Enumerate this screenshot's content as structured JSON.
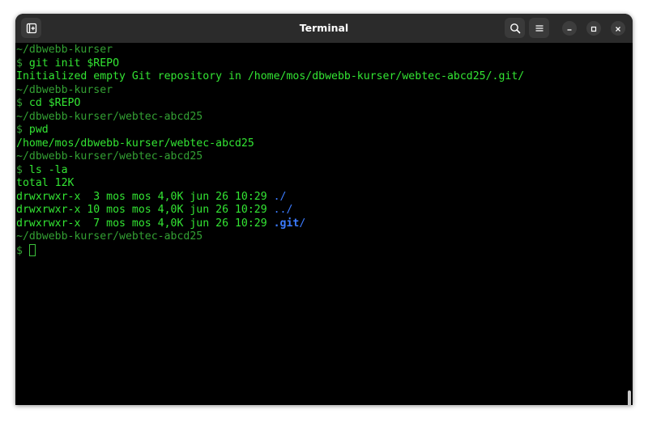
{
  "window": {
    "title": "Terminal"
  },
  "titlebar": {
    "new_tab_icon": "new-tab-icon",
    "search_icon": "search-icon",
    "menu_icon": "hamburger-menu-icon",
    "minimize_icon": "minimize-icon",
    "maximize_icon": "maximize-icon",
    "close_icon": "close-icon"
  },
  "colors": {
    "output_green": "#33e533",
    "prompt_dim_green": "#33a033",
    "directory_blue": "#3b7bff",
    "titlebar_bg": "#2b2b2b",
    "terminal_bg": "#000000"
  },
  "terminal": {
    "lines": [
      {
        "kind": "prompt-path",
        "segments": [
          {
            "text": "~/dbwebb-kurser",
            "color": "dim"
          }
        ]
      },
      {
        "kind": "command",
        "segments": [
          {
            "text": "$ ",
            "color": "dim"
          },
          {
            "text": "git init $REPO",
            "color": "green"
          }
        ]
      },
      {
        "kind": "output",
        "segments": [
          {
            "text": "Initialized empty Git repository in /home/mos/dbwebb-kurser/webtec-abcd25/.git/",
            "color": "green"
          }
        ]
      },
      {
        "kind": "prompt-path",
        "segments": [
          {
            "text": "~/dbwebb-kurser",
            "color": "dim"
          }
        ]
      },
      {
        "kind": "command",
        "segments": [
          {
            "text": "$ ",
            "color": "dim"
          },
          {
            "text": "cd $REPO",
            "color": "green"
          }
        ]
      },
      {
        "kind": "prompt-path",
        "segments": [
          {
            "text": "~/dbwebb-kurser/webtec-abcd25",
            "color": "dim"
          }
        ]
      },
      {
        "kind": "command",
        "segments": [
          {
            "text": "$ ",
            "color": "dim"
          },
          {
            "text": "pwd",
            "color": "green"
          }
        ]
      },
      {
        "kind": "output",
        "segments": [
          {
            "text": "/home/mos/dbwebb-kurser/webtec-abcd25",
            "color": "green"
          }
        ]
      },
      {
        "kind": "prompt-path",
        "segments": [
          {
            "text": "~/dbwebb-kurser/webtec-abcd25",
            "color": "dim"
          }
        ]
      },
      {
        "kind": "command",
        "segments": [
          {
            "text": "$ ",
            "color": "dim"
          },
          {
            "text": "ls -la",
            "color": "green"
          }
        ]
      },
      {
        "kind": "output",
        "segments": [
          {
            "text": "total 12K",
            "color": "green"
          }
        ]
      },
      {
        "kind": "output",
        "segments": [
          {
            "text": "drwxrwxr-x  3 mos mos 4,0K jun 26 10:29 ",
            "color": "green"
          },
          {
            "text": "./",
            "color": "blue"
          }
        ]
      },
      {
        "kind": "output",
        "segments": [
          {
            "text": "drwxrwxr-x 10 mos mos 4,0K jun 26 10:29 ",
            "color": "green"
          },
          {
            "text": "../",
            "color": "blue"
          }
        ]
      },
      {
        "kind": "output",
        "segments": [
          {
            "text": "drwxrwxr-x  7 mos mos 4,0K jun 26 10:29 ",
            "color": "green"
          },
          {
            "text": ".git",
            "color": "blue-bold"
          },
          {
            "text": "/",
            "color": "blue"
          }
        ]
      },
      {
        "kind": "prompt-path",
        "segments": [
          {
            "text": "~/dbwebb-kurser/webtec-abcd25",
            "color": "dim"
          }
        ]
      },
      {
        "kind": "current-prompt",
        "segments": [
          {
            "text": "$",
            "color": "dim"
          }
        ],
        "cursor": true
      }
    ]
  }
}
